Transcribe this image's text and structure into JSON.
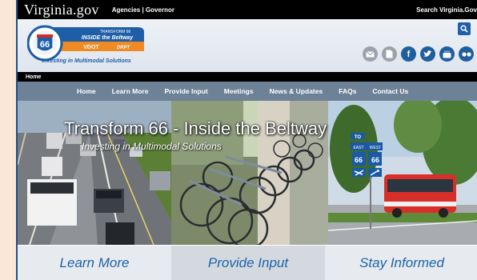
{
  "topbar": {
    "brand": "Virginia.gov",
    "links": "Agencies | Governor",
    "search": "Search Virginia.Gov"
  },
  "logo": {
    "route": "66",
    "line1": "TRANSFORM 66",
    "line2": "INSIDE the Beltway",
    "vdot": "VDOT",
    "drpt": "DRPT",
    "tagline": "Investing in Multimodal Solutions"
  },
  "social": [
    "email-icon",
    "document-icon",
    "facebook-icon",
    "twitter-icon",
    "youtube-icon",
    "flickr-icon"
  ],
  "breadcrumb": "Home",
  "nav": [
    "Home",
    "Learn More",
    "Provide Input",
    "Meetings",
    "News & Updates",
    "FAQs",
    "Contact Us"
  ],
  "hero": {
    "title": "Transform 66 - Inside the Beltway",
    "subtitle": "Investing in Multimodal Solutions",
    "sign": {
      "to": "TO",
      "east": "EAST",
      "west": "WEST",
      "route": "66"
    }
  },
  "tiles": [
    "Learn More",
    "Provide Input",
    "Stay Informed"
  ],
  "colors": {
    "nav": "#6d8197",
    "accent": "#1c63a8",
    "topbar": "#000000"
  }
}
